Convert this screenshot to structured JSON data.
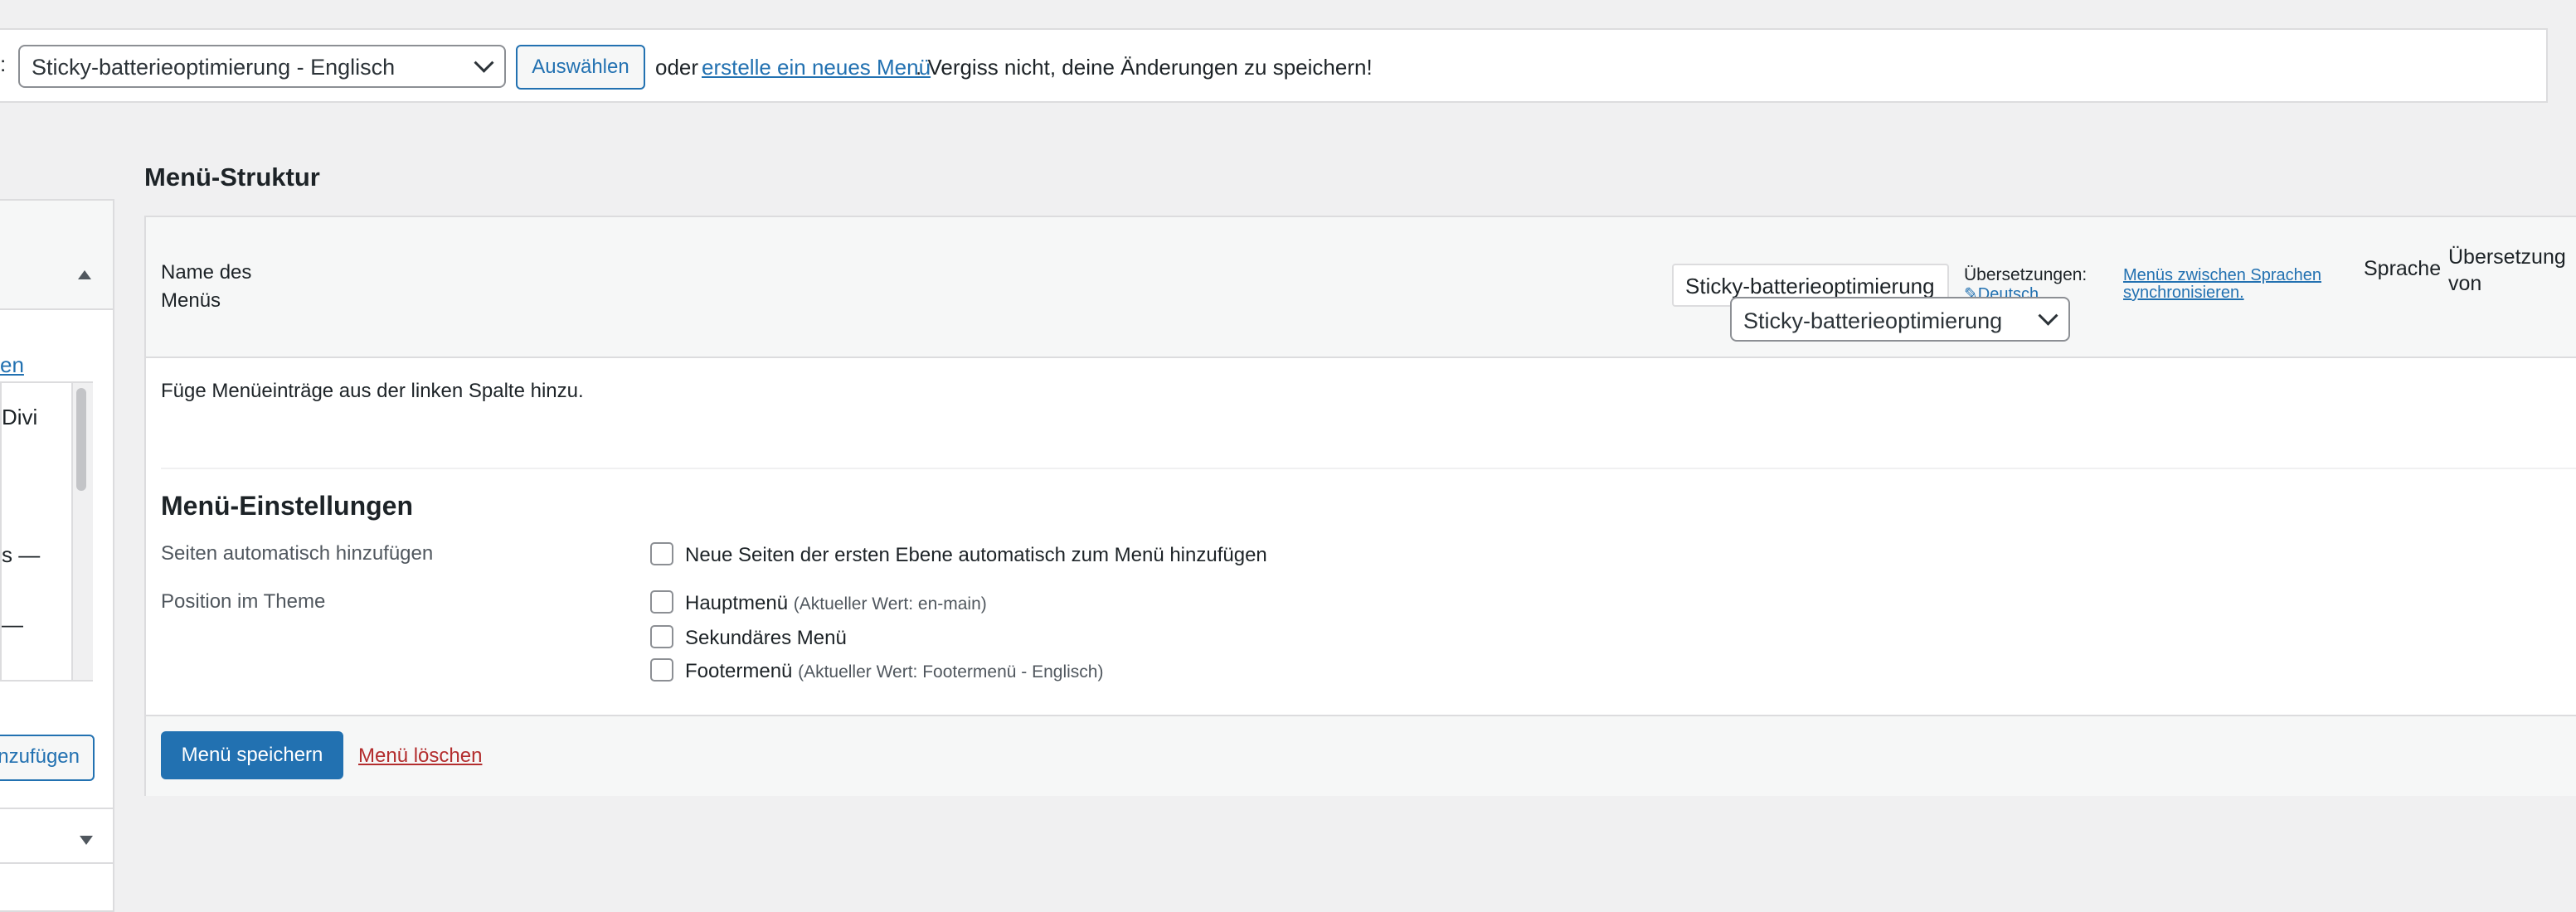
{
  "top_bar": {
    "label_fragment": ":",
    "menu_select_value": "Sticky-batterieoptimierung - Englisch",
    "select_button": "Auswählen",
    "text_or": "oder",
    "create_link": "erstelle ein neues Menü",
    "text_reminder": ". Vergiss nicht, deine Änderungen zu speichern!"
  },
  "sidebar": {
    "link_fragment": "en",
    "list_items": [
      "Divi",
      "s —",
      "—"
    ],
    "add_button_fragment": "nzufügen"
  },
  "structure": {
    "title": "Menü-Struktur",
    "name_label": "Name des Menüs",
    "name_value": "Sticky-batterieoptimierung",
    "translations_label": "Übersetzungen:",
    "translation_link": "Deutsch",
    "dropdown_value": "Sticky-batterieoptimierung",
    "sync_link": "Menüs zwischen Sprachen synchronisieren.",
    "language_label": "Sprache",
    "translation_of_label": "Übersetzung von",
    "empty_hint": "Füge Menüeinträge aus der linken Spalte hinzu."
  },
  "settings": {
    "title": "Menü-Einstellungen",
    "auto_add_label": "Seiten automatisch hinzufügen",
    "auto_add_option": "Neue Seiten der ersten Ebene automatisch zum Menü hinzufügen",
    "position_label": "Position im Theme",
    "locations": [
      {
        "name": "Hauptmenü",
        "note": "(Aktueller Wert: en-main)"
      },
      {
        "name": "Sekundäres Menü",
        "note": ""
      },
      {
        "name": "Footermenü",
        "note": "(Aktueller Wert: Footermenü - Englisch)"
      }
    ]
  },
  "actions": {
    "save": "Menü speichern",
    "delete": "Menü löschen"
  },
  "colors": {
    "primary": "#2271b1",
    "delete": "#b32d2e",
    "background": "#f0f0f1"
  }
}
